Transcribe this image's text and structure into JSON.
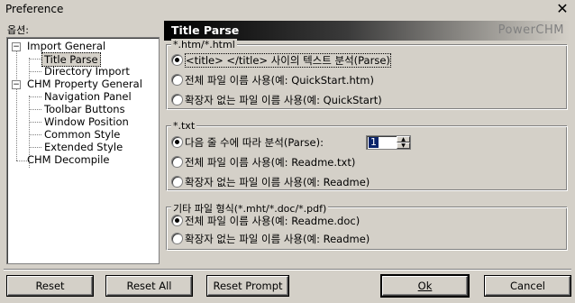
{
  "window": {
    "title": "Preference",
    "close_glyph": "✕"
  },
  "options_label": "옵션:",
  "tree": {
    "items": [
      {
        "label": "Import General"
      },
      {
        "label": "Title Parse"
      },
      {
        "label": "Directory Import"
      },
      {
        "label": "CHM Property General"
      },
      {
        "label": "Navigation Panel"
      },
      {
        "label": "Toolbar Buttons"
      },
      {
        "label": "Window Position"
      },
      {
        "label": "Common Style"
      },
      {
        "label": "Extended Style"
      },
      {
        "label": "CHM Decompile"
      }
    ]
  },
  "panel": {
    "title": "Title Parse",
    "brand": "PowerCHM"
  },
  "groups": [
    {
      "title": "*.htm/*.html",
      "options": [
        {
          "label": "<title> </title> 사이의 텍스트 분석(Parse)",
          "checked": true
        },
        {
          "label": "전체 파일 이름 사용(예: QuickStart.htm)",
          "checked": false
        },
        {
          "label": "확장자 없는 파일 이름 사용(예: QuickStart)",
          "checked": false
        }
      ]
    },
    {
      "title": "*.txt",
      "options": [
        {
          "label": "다음 줄 수에 따라 분석(Parse):",
          "checked": true
        },
        {
          "label": "전체 파일 이름 사용(예: Readme.txt)",
          "checked": false
        },
        {
          "label": "확장자 없는 파일 이름 사용(예: Readme)",
          "checked": false
        }
      ],
      "spinner_value": "1"
    },
    {
      "title": "기타 파일 형식(*.mht/*.doc/*.pdf)",
      "options": [
        {
          "label": "전체 파일 이름 사용(예: Readme.doc)",
          "checked": true
        },
        {
          "label": "확장자 없는 파일 이름 사용(예: Readme)",
          "checked": false
        }
      ]
    }
  ],
  "buttons": {
    "reset": "Reset",
    "reset_all": "Reset All",
    "reset_prompt": "Reset Prompt",
    "ok": "Ok",
    "cancel": "Cancel"
  }
}
